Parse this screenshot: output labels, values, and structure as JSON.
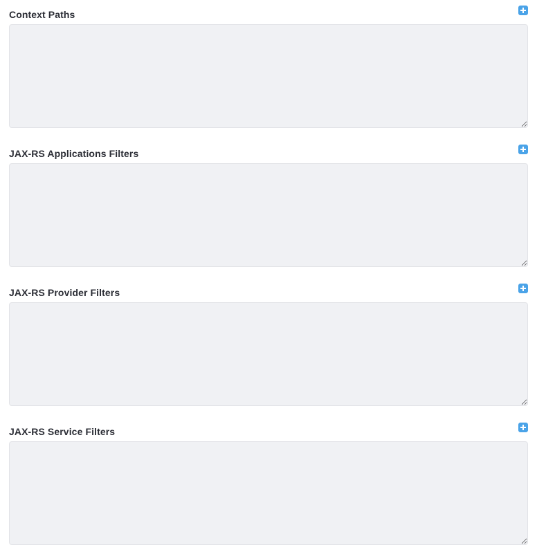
{
  "fields": [
    {
      "label": "Context Paths",
      "value": "",
      "add_icon": "plus-square-icon"
    },
    {
      "label": "JAX-RS Applications Filters",
      "value": "",
      "add_icon": "plus-square-icon"
    },
    {
      "label": "JAX-RS Provider Filters",
      "value": "",
      "add_icon": "plus-square-icon"
    },
    {
      "label": "JAX-RS Service Filters",
      "value": "",
      "add_icon": "plus-square-icon"
    }
  ],
  "colors": {
    "accent": "#4aa3e8",
    "textarea_bg": "#f0f1f4",
    "label_text": "#2b2d35"
  }
}
